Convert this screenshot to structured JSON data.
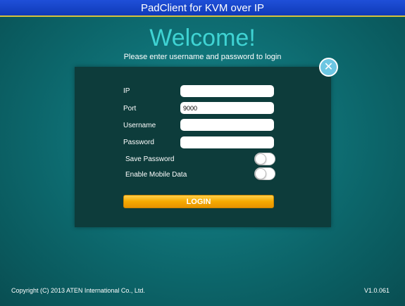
{
  "window": {
    "title": "PadClient for KVM over IP"
  },
  "header": {
    "welcome": "Welcome!",
    "subtitle": "Please enter username and password to login"
  },
  "close_icon": "close-icon",
  "form": {
    "ip": {
      "label": "IP",
      "value": ""
    },
    "port": {
      "label": "Port",
      "value": "9000"
    },
    "username": {
      "label": "Username",
      "value": ""
    },
    "password": {
      "label": "Password",
      "value": ""
    },
    "save_password": {
      "label": "Save Password",
      "on": false
    },
    "enable_mobile_data": {
      "label": "Enable Mobile Data",
      "on": false
    },
    "login_label": "LOGIN"
  },
  "footer": {
    "copyright": "Copyright (C) 2013  ATEN International Co., Ltd.",
    "version": "V1.0.061"
  },
  "colors": {
    "title_bar": "#1f4fd8",
    "welcome_text": "#3fd3d3",
    "panel": "#0d3c3b",
    "login_button": "#f5a900",
    "close_button": "#6cc6e2"
  }
}
